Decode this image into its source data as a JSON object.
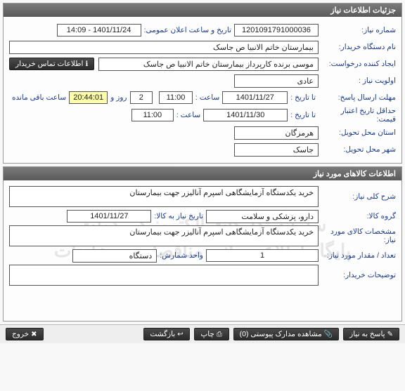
{
  "panel1": {
    "title": "جزئیات اطلاعات نیاز",
    "need_no_label": "شماره نیاز:",
    "need_no": "1201091791000036",
    "announce_label": "تاریخ و ساعت اعلان عمومی:",
    "announce_val": "1401/11/24 - 14:09",
    "buyer_label": "نام دستگاه خریدار:",
    "buyer_val": "بیمارستان خاتم الانبیا  ص  جاسک",
    "requester_label": "ایجاد کننده درخواست:",
    "requester_val": "موسی  برنده کارپرداز بیمارستان خاتم الانبیا  ص  جاسک",
    "contact_btn": "اطلاعات تماس خریدار",
    "priority_label": "اولویت نیاز :",
    "priority_val": "عادی",
    "deadline_label": "مهلت ارسال پاسخ:",
    "to_date_label": "تا تاریخ :",
    "deadline_date": "1401/11/27",
    "time_label": "ساعت :",
    "deadline_time": "11:00",
    "days_val": "2",
    "days_label": "روز و",
    "countdown": "20:44:01",
    "remain_label": "ساعت باقی مانده",
    "price_valid_label": "حداقل تاریخ اعتبار قیمت:",
    "price_valid_date": "1401/11/30",
    "price_valid_time": "11:00",
    "province_label": "استان محل تحویل:",
    "province_val": "هرمزگان",
    "city_label": "شهر محل تحویل:",
    "city_val": "جاسک"
  },
  "panel2": {
    "title": "اطلاعات کالاهای مورد نیاز",
    "desc_label": "شرح کلی نیاز:",
    "desc_val": "خرید یکدستگاه آزمایشگاهی اسپرم آنالیزر جهت بیمارستان",
    "group_label": "گروه کالا:",
    "group_val": "دارو، پزشکی و سلامت",
    "need_date_label": "تاریخ نیاز به کالا:",
    "need_date_val": "1401/11/27",
    "spec_label": "مشخصات کالای مورد نیاز:",
    "spec_val": "خرید یکدستگاه آزمایشگاهی اسپرم آنالیزر جهت بیمارستان",
    "qty_label": "تعداد / مقدار مورد نیاز:",
    "qty_val": "1",
    "unit_label": "واحد شمارش:",
    "unit_val": "دستگاه",
    "buyer_note_label": "توضیحات خریدار:",
    "buyer_note_val": ""
  },
  "toolbar": {
    "reply": "پاسخ به نیاز",
    "attach": "مشاهده مدارک پیوستی (0)",
    "print": "چاپ",
    "back": "بازگشت",
    "exit": "خروج"
  },
  "watermark": {
    "line1": "سامانه تدارکات الکترونیکی دولت",
    "line2": "پایگاه اطلاع رسانی مناقصات و مزایدات",
    "line3": "۰۲۱-۸۸۳۴۹۶۷۰-۵"
  }
}
